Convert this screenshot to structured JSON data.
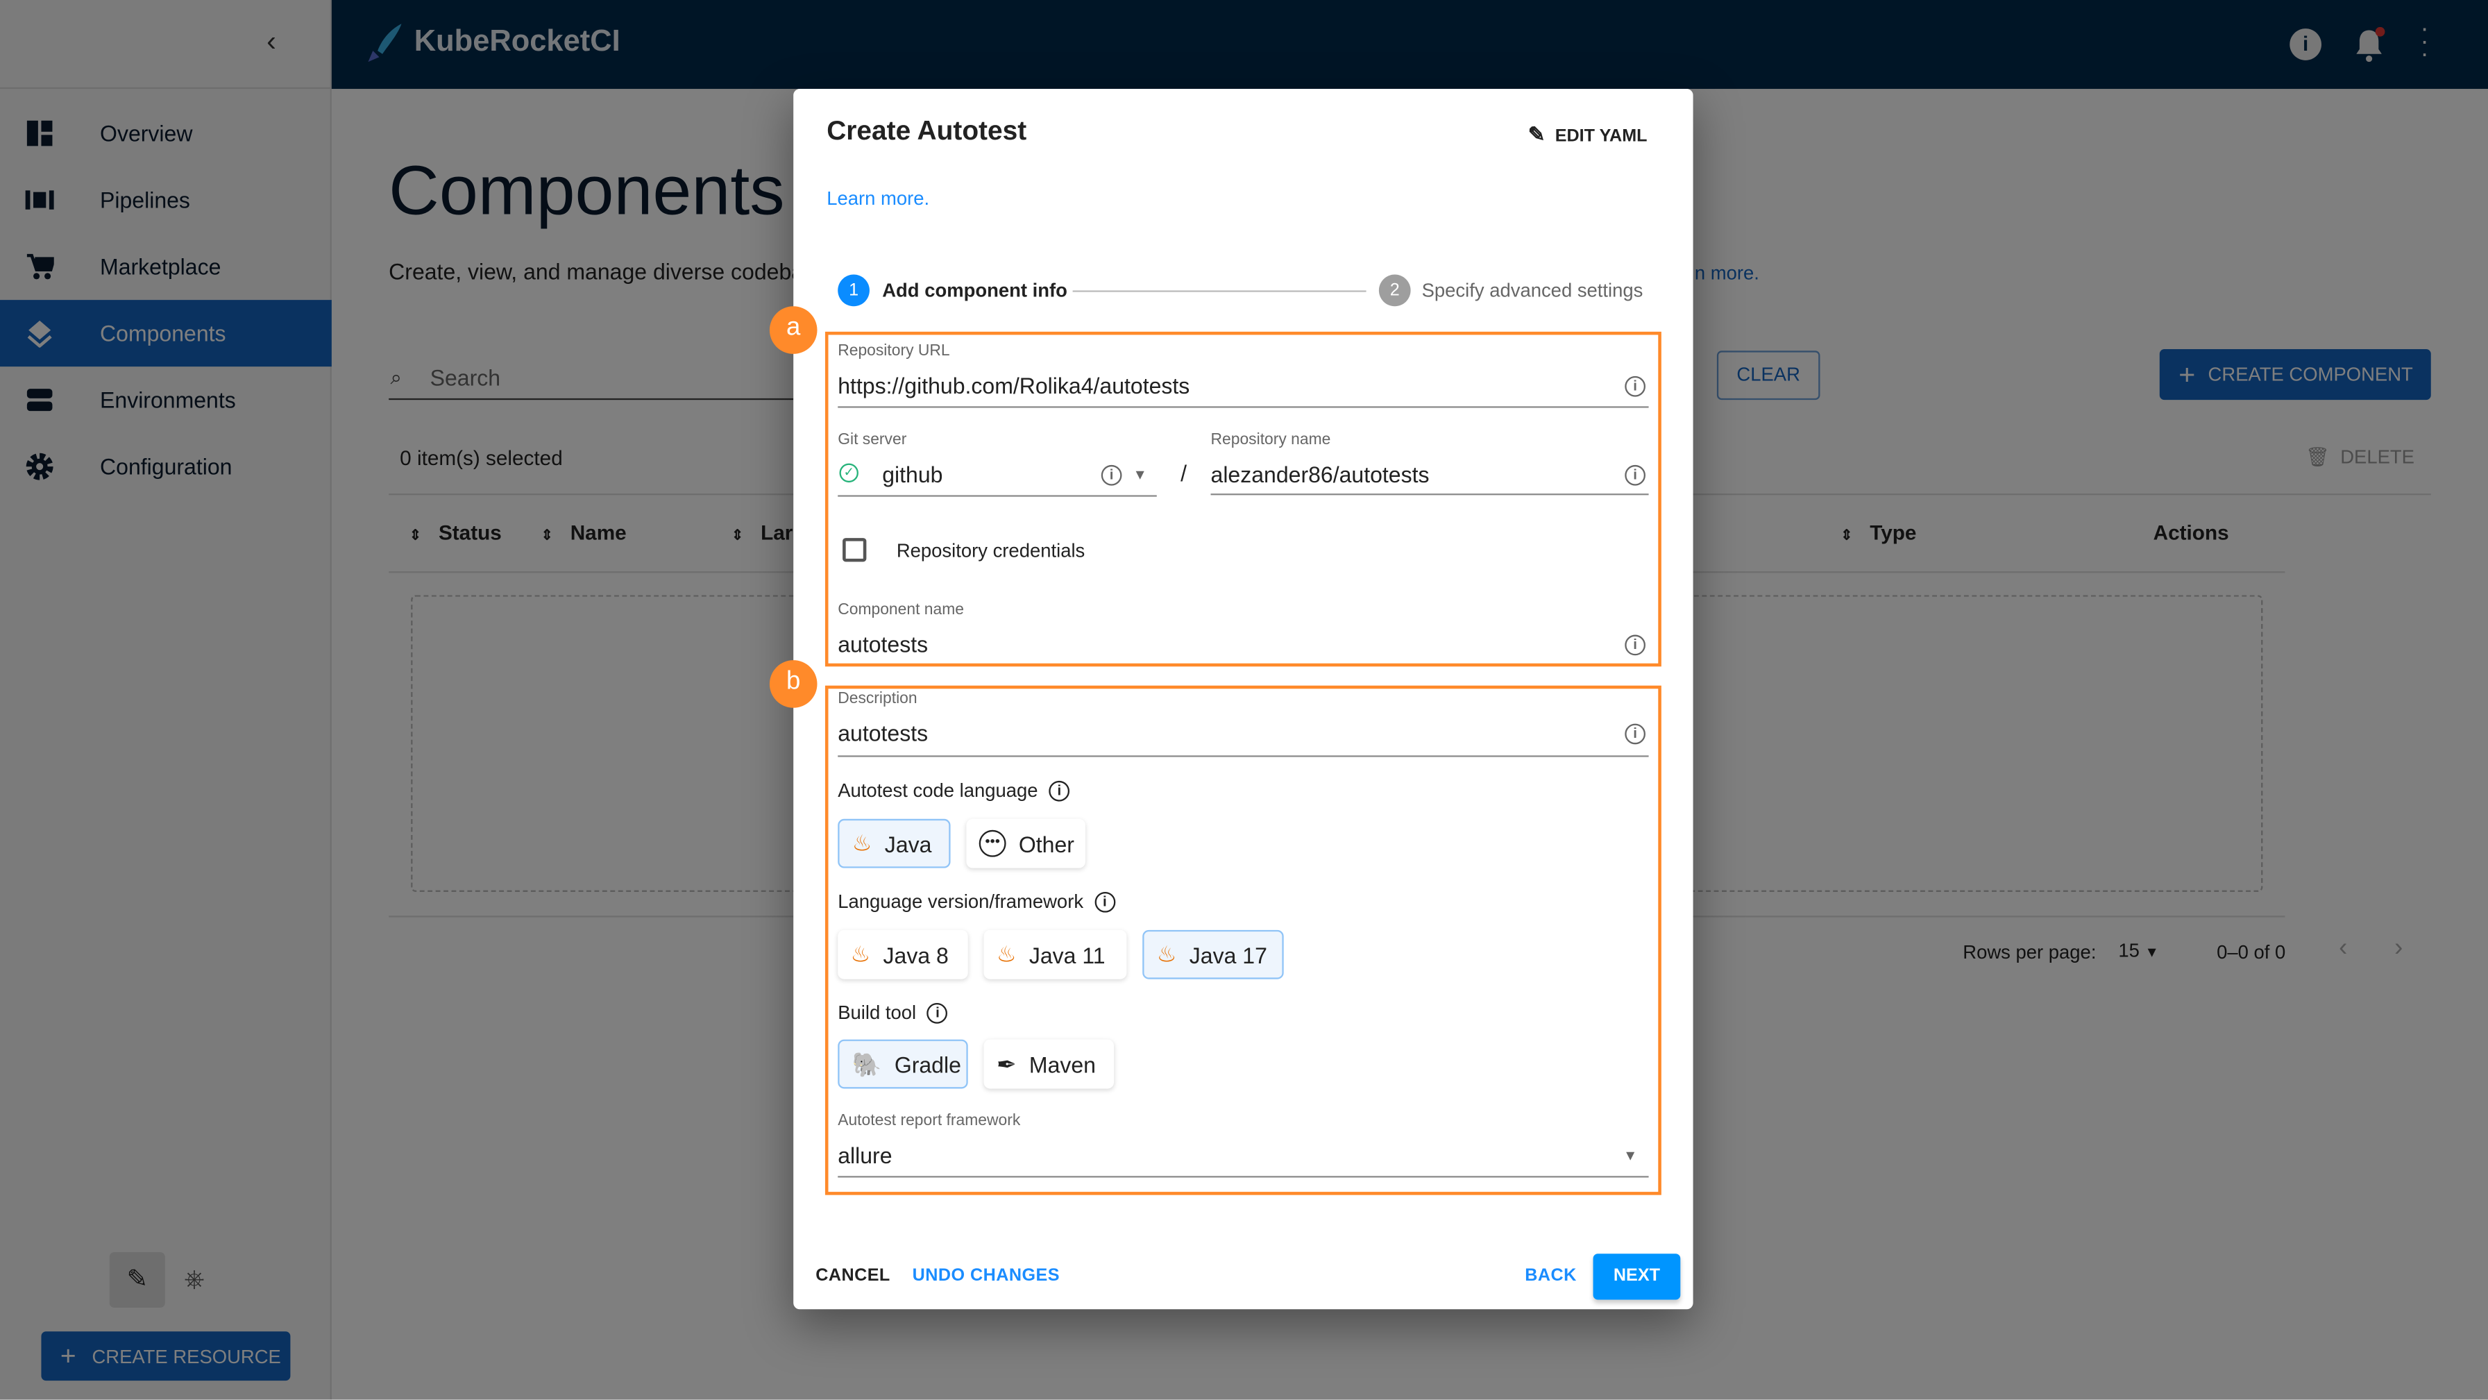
{
  "app": {
    "title": "KubeRocketCI"
  },
  "sidebar": {
    "items": [
      {
        "label": "Overview",
        "icon": "dashboard-icon"
      },
      {
        "label": "Pipelines",
        "icon": "pipelines-icon"
      },
      {
        "label": "Marketplace",
        "icon": "cart-icon"
      },
      {
        "label": "Components",
        "icon": "layers-icon",
        "selected": true
      },
      {
        "label": "Environments",
        "icon": "environments-icon"
      },
      {
        "label": "Configuration",
        "icon": "gear-icon"
      }
    ],
    "create_resource": "CREATE RESOURCE"
  },
  "page": {
    "title": "Components",
    "subtitle": "Create, view, and manage diverse codeba",
    "subtitle_link": "n more.",
    "search_placeholder": "Search",
    "clear": "CLEAR",
    "create_component": "CREATE COMPONENT",
    "selected": "0 item(s) selected",
    "delete": "DELETE",
    "columns": [
      "Status",
      "Name",
      "Lar",
      "Type",
      "Actions"
    ],
    "rows_per_page_label": "Rows per page:",
    "rows_per_page": "15",
    "range": "0–0 of 0"
  },
  "dialog": {
    "title": "Create Autotest",
    "edit_yaml": "EDIT YAML",
    "learn_more": "Learn more.",
    "steps": [
      {
        "num": "1",
        "label": "Add component info",
        "active": true
      },
      {
        "num": "2",
        "label": "Specify advanced settings",
        "active": false
      }
    ],
    "annotations": [
      "a",
      "b"
    ],
    "repo_url": {
      "label": "Repository URL",
      "value": "https://github.com/Rolika4/autotests"
    },
    "git_server": {
      "label": "Git server",
      "value": "github"
    },
    "separator": "/",
    "repo_name": {
      "label": "Repository name",
      "value": "alezander86/autotests"
    },
    "repo_credentials": {
      "label": "Repository credentials",
      "checked": false
    },
    "component_name": {
      "label": "Component name",
      "value": "autotests"
    },
    "description": {
      "label": "Description",
      "value": "autotests"
    },
    "code_language": {
      "label": "Autotest code language",
      "options": [
        "Java",
        "Other"
      ],
      "selected": "Java"
    },
    "language_version": {
      "label": "Language version/framework",
      "options": [
        "Java 8",
        "Java 11",
        "Java 17"
      ],
      "selected": "Java 17"
    },
    "build_tool": {
      "label": "Build tool",
      "options": [
        "Gradle",
        "Maven"
      ],
      "selected": "Gradle"
    },
    "report_framework": {
      "label": "Autotest report framework",
      "value": "allure"
    },
    "footer": {
      "cancel": "CANCEL",
      "undo": "UNDO CHANGES",
      "back": "BACK",
      "next": "NEXT"
    }
  },
  "colors": {
    "accent": "#0095ff",
    "annotation": "#ff8a2a",
    "topbar": "#002a4d",
    "selected_nav": "#1565c0"
  }
}
